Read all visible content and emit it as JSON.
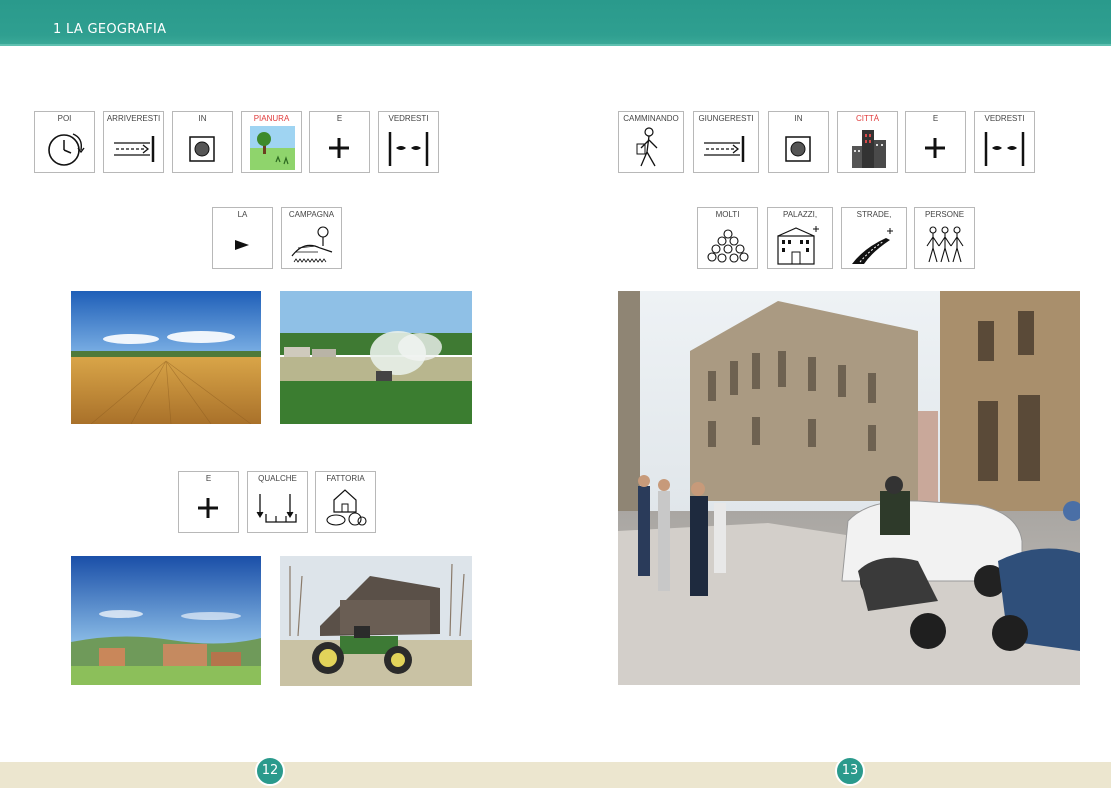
{
  "header": {
    "title": "1  LA GEOGRAFIA"
  },
  "left_page": {
    "row1": [
      {
        "label": "POI",
        "icon": "clock-icon",
        "color": "#444"
      },
      {
        "label": "ARRIVERESTI",
        "icon": "arrive-arrow-icon",
        "color": "#444"
      },
      {
        "label": "IN",
        "icon": "in-square-icon",
        "color": "#444"
      },
      {
        "label": "PIANURA",
        "icon": "plain-tree-icon",
        "color": "#e03a3a"
      },
      {
        "label": "E",
        "icon": "plus-icon",
        "color": "#444"
      },
      {
        "label": "VEDRESTI",
        "icon": "eyes-icon",
        "color": "#444"
      }
    ],
    "row2": [
      {
        "label": "LA",
        "icon": "triangle-pointer-icon"
      },
      {
        "label": "CAMPAGNA",
        "icon": "countryside-icon"
      }
    ],
    "row3": [
      {
        "label": "E",
        "icon": "plus-icon"
      },
      {
        "label": "QUALCHE",
        "icon": "some-arrows-icon"
      },
      {
        "label": "FATTORIA",
        "icon": "farm-icon"
      }
    ],
    "page_number": "12"
  },
  "right_page": {
    "row1": [
      {
        "label": "CAMMINANDO",
        "icon": "walking-person-icon",
        "color": "#444"
      },
      {
        "label": "GIUNGERESTI",
        "icon": "arrive-arrow-icon",
        "color": "#444"
      },
      {
        "label": "IN",
        "icon": "in-square-icon",
        "color": "#444"
      },
      {
        "label": "CITTÀ",
        "icon": "city-icon",
        "color": "#e03a3a"
      },
      {
        "label": "E",
        "icon": "plus-icon",
        "color": "#444"
      },
      {
        "label": "VEDRESTI",
        "icon": "eyes-icon",
        "color": "#444"
      }
    ],
    "row2": [
      {
        "label": "MOLTI",
        "icon": "many-balls-icon"
      },
      {
        "label": "PALAZZI,",
        "icon": "buildings-plus-icon"
      },
      {
        "label": "STRADE,",
        "icon": "road-plus-icon"
      },
      {
        "label": "PERSONE",
        "icon": "people-icon"
      }
    ],
    "page_number": "13"
  },
  "colors": {
    "accent": "#2a9a8c",
    "footer": "#ece6cf",
    "highlight_label": "#e03a3a"
  }
}
